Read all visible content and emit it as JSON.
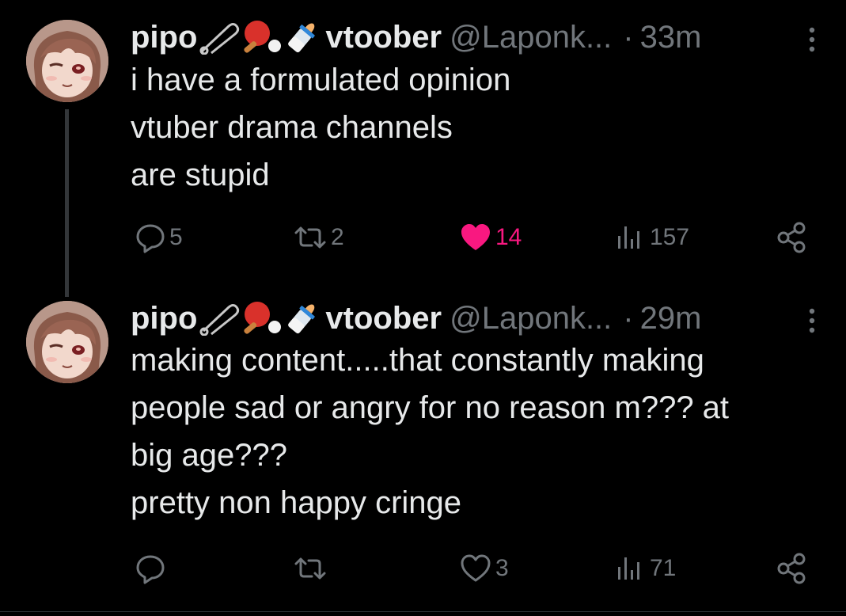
{
  "tweets": [
    {
      "display_name": "pipo",
      "emojis": [
        "safety-pin",
        "ping-pong",
        "baby-bottle"
      ],
      "name_suffix": "vtoober",
      "handle": "@Laponk...",
      "separator": "·",
      "time": "33m",
      "lines": [
        "i have a formulated opinion",
        "vtuber drama channels",
        "are stupid"
      ],
      "replies": "5",
      "reposts": "2",
      "likes": "14",
      "liked": true,
      "views": "157"
    },
    {
      "display_name": "pipo",
      "emojis": [
        "safety-pin",
        "ping-pong",
        "baby-bottle"
      ],
      "name_suffix": "vtoober",
      "handle": "@Laponk...",
      "separator": "·",
      "time": "29m",
      "lines": [
        "making content.....that constantly making",
        "people sad or angry for no reason m??? at",
        "big age???",
        "pretty non happy cringe"
      ],
      "replies": "",
      "reposts": "",
      "likes": "3",
      "liked": false,
      "views": "71"
    }
  ],
  "colors": {
    "background": "#000000",
    "text": "#e7e9ea",
    "muted": "#71767b",
    "like": "#f91880",
    "thread_line": "#333639"
  }
}
